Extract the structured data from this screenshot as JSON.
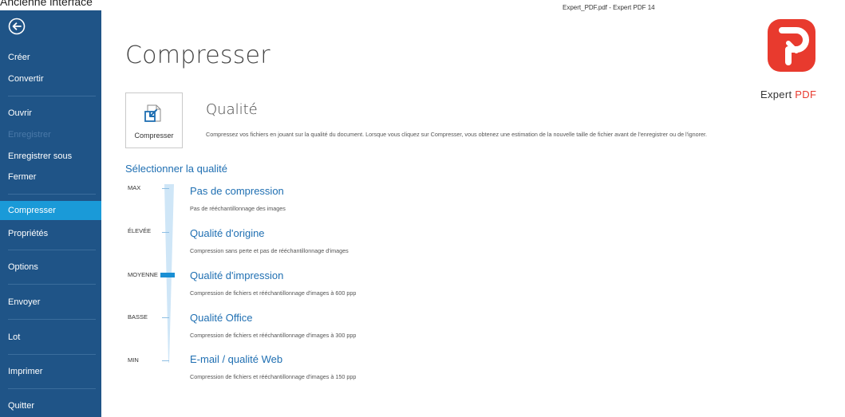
{
  "caption": "Ancienne interface",
  "window_title": "Expert_PDF.pdf  -  Expert PDF 14",
  "sidebar": {
    "items": [
      {
        "label": "Créer",
        "state": "normal"
      },
      {
        "label": "Convertir",
        "state": "normal"
      },
      {
        "label": "Ouvrir",
        "state": "normal"
      },
      {
        "label": "Enregistrer",
        "state": "disabled"
      },
      {
        "label": "Enregistrer sous",
        "state": "normal"
      },
      {
        "label": "Fermer",
        "state": "normal"
      },
      {
        "label": "Compresser",
        "state": "active"
      },
      {
        "label": "Propriétés",
        "state": "normal"
      },
      {
        "label": "Options",
        "state": "normal"
      },
      {
        "label": "Envoyer",
        "state": "normal"
      },
      {
        "label": "Lot",
        "state": "normal"
      },
      {
        "label": "Imprimer",
        "state": "normal"
      },
      {
        "label": "Quitter",
        "state": "normal"
      }
    ]
  },
  "main": {
    "title": "Compresser",
    "tile_label": "Compresser",
    "section_title": "Qualité",
    "section_desc": "Compressez vos fichiers en jouant sur la qualité du document. Lorsque vous cliquez sur Compresser, vous obtenez une estimation de la nouvelle taille de fichier avant de l'enregistrer ou de l'ignorer.",
    "select_heading": "Sélectionner la qualité",
    "levels": [
      "MAX",
      "ÉLEVÉE",
      "MOYENNE",
      "BASSE",
      "MIN"
    ],
    "selected_level": "MOYENNE",
    "options": [
      {
        "title": "Pas de compression",
        "desc": "Pas de rééchantillonnage des images"
      },
      {
        "title": "Qualité d'origine",
        "desc": "Compression sans perte et pas de rééchantillonnage d'images"
      },
      {
        "title": "Qualité d'impression",
        "desc": "Compression de fichiers et rééchantillonnage d'images à 600 ppp"
      },
      {
        "title": "Qualité Office",
        "desc": "Compression de fichiers et rééchantillonnage d'images à 300 ppp"
      },
      {
        "title": "E-mail / qualité Web",
        "desc": "Compression de fichiers et rééchantillonnage d'images à 150 ppp"
      }
    ]
  },
  "logo": {
    "brand": "Expert",
    "brand_accent": "PDF",
    "color": "#e83a2e"
  },
  "colors": {
    "sidebar": "#1f5487",
    "active": "#1a9ad8",
    "accent_text": "#1f6fb2"
  }
}
